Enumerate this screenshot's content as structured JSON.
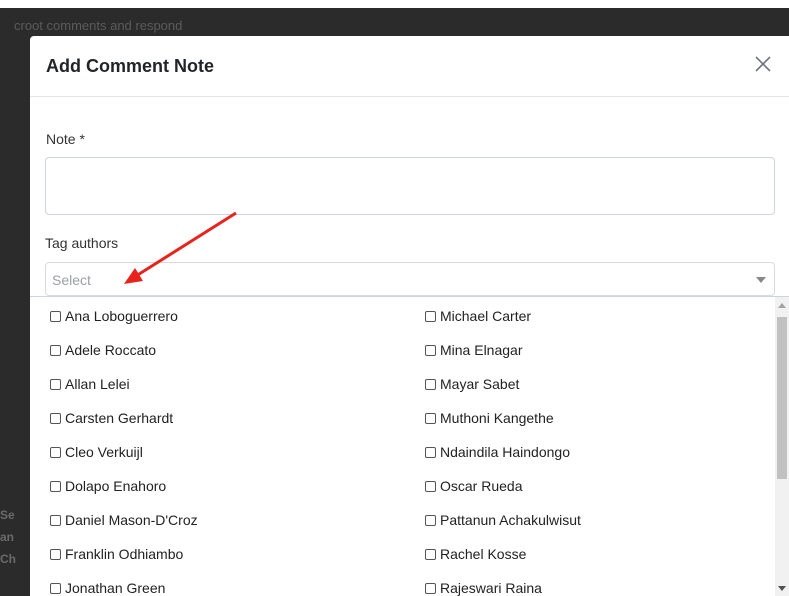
{
  "background": {
    "text": "croot comments and respond",
    "side_letters": [
      "Se",
      "an",
      "Ch"
    ]
  },
  "modal": {
    "title": "Add Comment Note",
    "close_icon": "close-icon",
    "note_label": "Note *",
    "note_value": "",
    "tag_label": "Tag authors",
    "select_placeholder": "Select"
  },
  "options": {
    "left": [
      "Ana Loboguerrero",
      "Adele Roccato",
      "Allan Lelei",
      "Carsten Gerhardt",
      "Cleo Verkuijl",
      "Dolapo Enahoro",
      "Daniel Mason-D'Croz",
      "Franklin Odhiambo",
      "Jonathan Green"
    ],
    "right": [
      "Michael Carter",
      "Mina Elnagar",
      "Mayar Sabet",
      "Muthoni Kangethe",
      "Ndaindila Haindongo",
      "Oscar Rueda",
      "Pattanun Achakulwisut",
      "Rachel Kosse",
      "Rajeswari Raina"
    ]
  },
  "colors": {
    "annotation_arrow": "#e8231d",
    "backdrop": "#2b2b2b"
  }
}
